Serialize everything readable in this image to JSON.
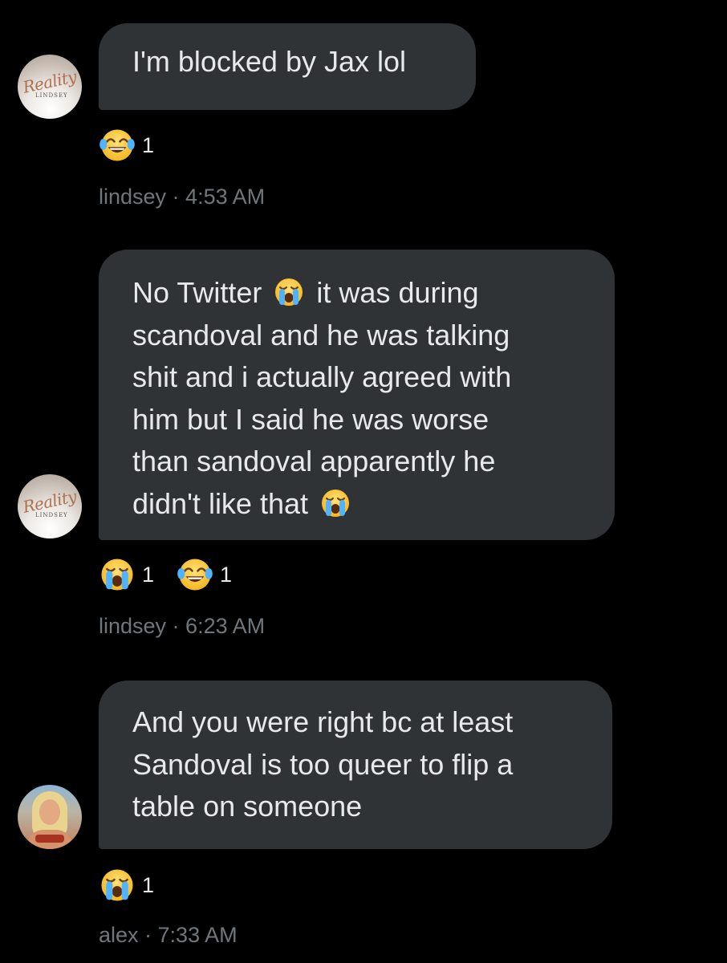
{
  "messages": [
    {
      "sender": "lindsey",
      "time": "4:53 AM",
      "avatar": {
        "type": "logo",
        "logo_text": "Reality",
        "logo_sub": "LINDSEY"
      },
      "lines": [
        "I'm blocked by Jax lol"
      ],
      "reactions": [
        {
          "icon": "joy-emoji",
          "count": "1"
        }
      ]
    },
    {
      "sender": "lindsey",
      "time": "6:23 AM",
      "avatar": {
        "type": "logo",
        "logo_text": "Reality",
        "logo_sub": "LINDSEY"
      },
      "line1_part1": "No Twitter",
      "line1_part2": "it was during",
      "lines": [
        "scandoval and he was talking",
        "shit and i actually agreed with",
        "him but I said he was worse",
        "than sandoval apparently he"
      ],
      "last_line": "didn't like that",
      "reactions": [
        {
          "icon": "sob-emoji",
          "count": "1"
        },
        {
          "icon": "joy-emoji",
          "count": "1"
        }
      ]
    },
    {
      "sender": "alex",
      "time": "7:33 AM",
      "avatar": {
        "type": "photo"
      },
      "lines": [
        "And you were right bc at least",
        "Sandoval is too queer to flip a",
        "table on someone"
      ],
      "reactions": [
        {
          "icon": "sob-emoji",
          "count": "1"
        }
      ]
    }
  ],
  "meta_separator": " · ",
  "colors": {
    "background": "#000000",
    "bubble": "#2f3336",
    "text": "#e7e9ea",
    "meta": "#71767b"
  }
}
